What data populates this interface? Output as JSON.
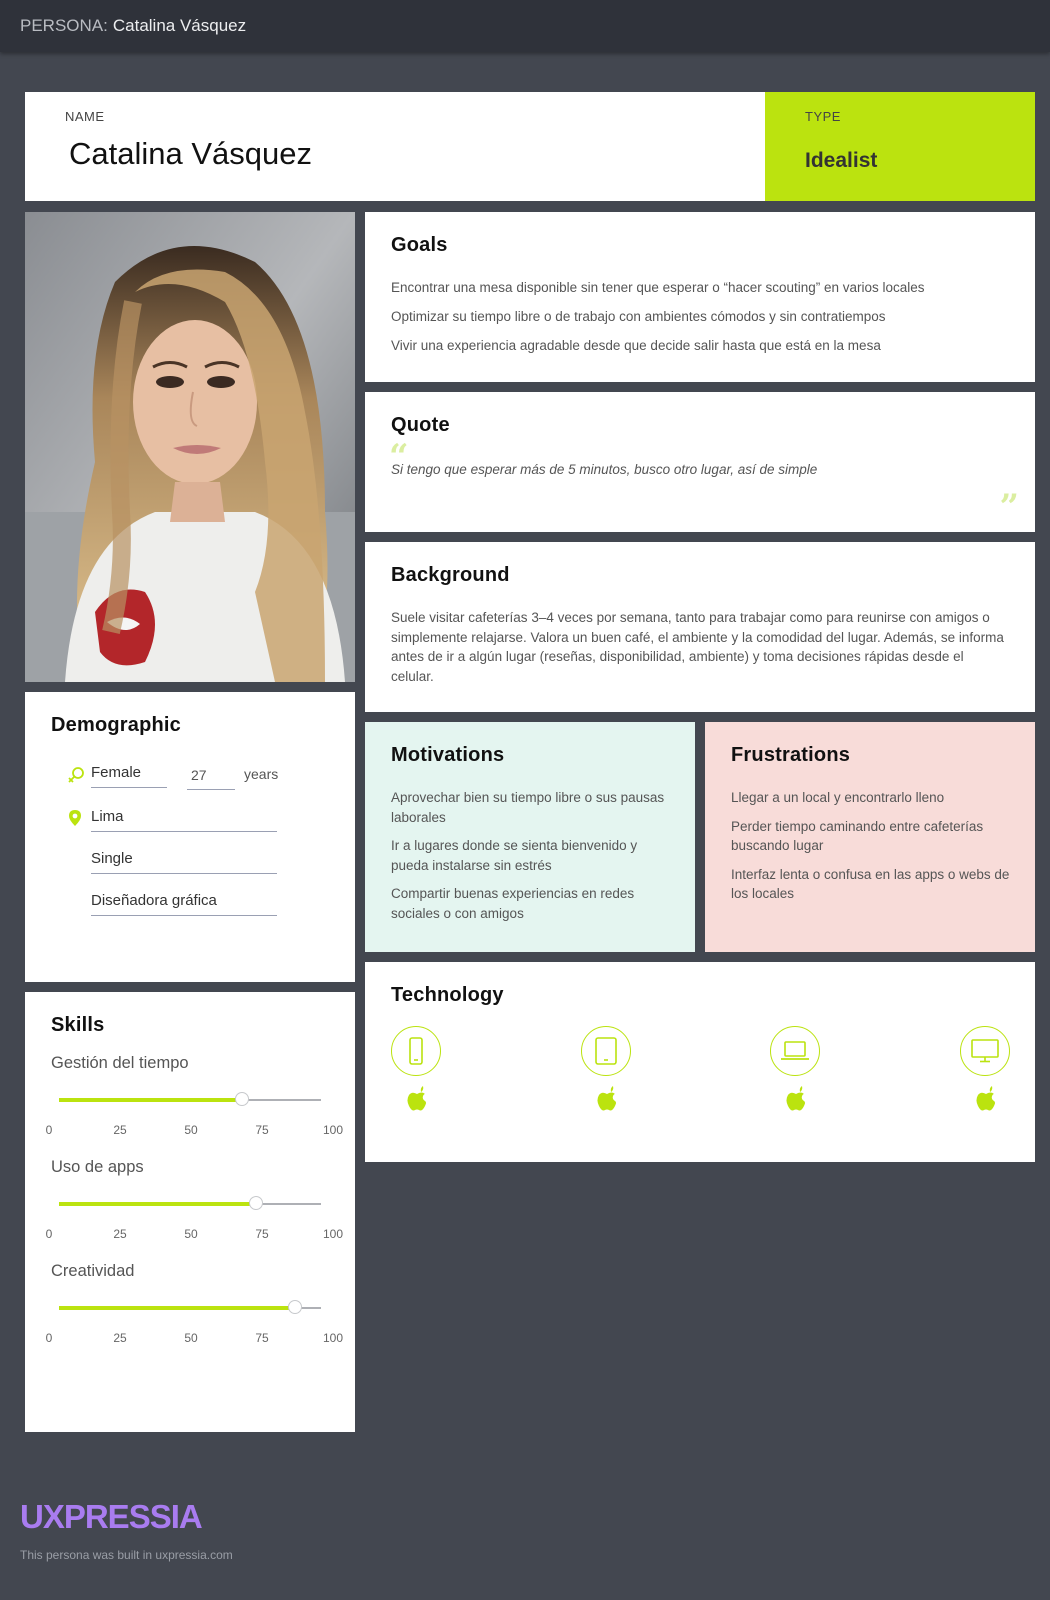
{
  "header": {
    "prefix": "PERSONA:",
    "name": "Catalina Vásquez"
  },
  "persona": {
    "name_label": "NAME",
    "name": "Catalina Vásquez",
    "type_label": "TYPE",
    "type": "Idealist"
  },
  "goals": {
    "title": "Goals",
    "items": [
      "Encontrar una mesa disponible sin tener que esperar o “hacer scouting” en varios locales",
      "Optimizar su tiempo libre o de trabajo con ambientes cómodos y sin contratiempos",
      "Vivir una experiencia agradable desde que decide salir hasta que está en la mesa"
    ]
  },
  "quote": {
    "title": "Quote",
    "text": "Si tengo que esperar más de 5 minutos, busco otro lugar, así de simple"
  },
  "background": {
    "title": "Background",
    "text": "Suele visitar cafeterías 3–4 veces por semana, tanto para trabajar como para reunirse con amigos o simplemente relajarse. Valora un buen café, el ambiente y la comodidad del lugar. Además, se informa antes de ir a algún lugar (reseñas, disponibilidad, ambiente) y toma decisiones rápidas desde el celular."
  },
  "motivations": {
    "title": "Motivations",
    "items": [
      "Aprovechar bien su tiempo libre o sus pausas laborales",
      "Ir a lugares donde se sienta bienvenido y pueda instalarse sin estrés",
      "Compartir buenas experiencias en redes sociales o con amigos"
    ]
  },
  "frustrations": {
    "title": "Frustrations",
    "items": [
      "Llegar a un local y encontrarlo lleno",
      "Perder tiempo caminando entre cafeterías buscando lugar",
      "Interfaz lenta o confusa en las apps o webs de los locales"
    ]
  },
  "technology": {
    "title": "Technology",
    "devices": [
      {
        "icon": "smartphone-icon",
        "os_icon": "apple-icon"
      },
      {
        "icon": "tablet-icon",
        "os_icon": "apple-icon"
      },
      {
        "icon": "laptop-icon",
        "os_icon": "apple-icon"
      },
      {
        "icon": "desktop-icon",
        "os_icon": "apple-icon"
      }
    ]
  },
  "demographic": {
    "title": "Demographic",
    "gender": "Female",
    "age": "27",
    "age_unit": "years",
    "location": "Lima",
    "status": "Single",
    "occupation": "Diseñadora gráfica"
  },
  "skills": {
    "title": "Skills",
    "scale": [
      "0",
      "25",
      "50",
      "75",
      "100"
    ],
    "items": [
      {
        "name": "Gestión del tiempo",
        "value": 70
      },
      {
        "name": "Uso de apps",
        "value": 75
      },
      {
        "name": "Creatividad",
        "value": 90
      }
    ]
  },
  "colors": {
    "accent": "#bbe30f",
    "background": "#434750",
    "topbar": "#2f323a",
    "motivations_bg": "#e4f5f0",
    "frustrations_bg": "#f8dcd9",
    "logo": "#a97cf0"
  },
  "footer": {
    "logo": "UXPRESSIA",
    "note": "This persona was built in uxpressia.com"
  }
}
